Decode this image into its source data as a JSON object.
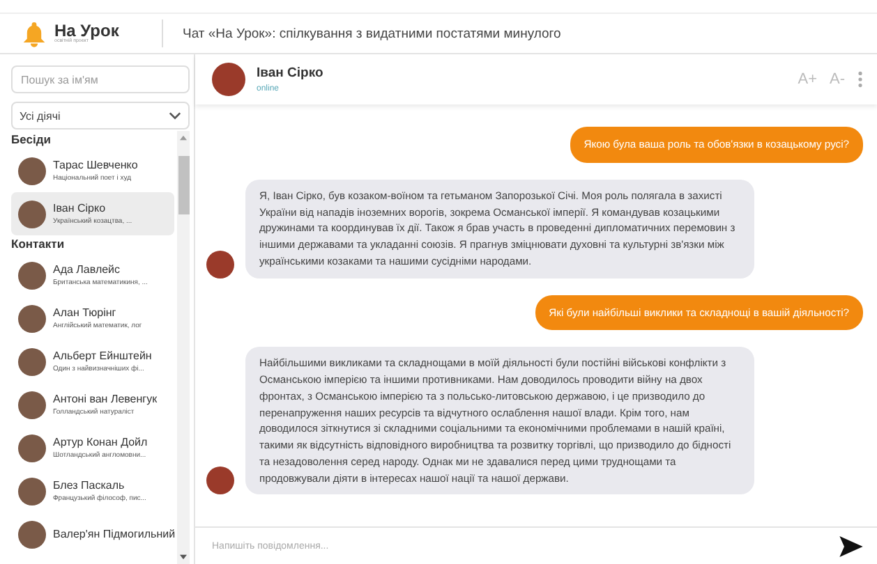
{
  "header": {
    "logo": "На Урок",
    "logo_tagline": "освітній проект",
    "title": "Чат «На Урок»: спілкування з видатними постатями минулого"
  },
  "sidebar": {
    "search": {
      "placeholder": "Пошук за ім'ям"
    },
    "filter": "Усі діячі",
    "sections": [
      {
        "title": "Бесіди",
        "items": [
          {
            "name": "Тарас Шевченко",
            "subtitle": "Національний поет і худ",
            "selected": false
          },
          {
            "name": "Іван Сірко",
            "subtitle": "Український козацтва, ...",
            "selected": true
          }
        ]
      },
      {
        "title": "Контакти",
        "items": [
          {
            "name": "Ада Лавлейс",
            "subtitle": "Британська математикиня, ...",
            "selected": false
          },
          {
            "name": "Алан Тюрінг",
            "subtitle": "Англійський математик, лог",
            "selected": false
          },
          {
            "name": "Альберт Ейнштейн",
            "subtitle": "Один з найвизначніших фі...",
            "selected": false
          },
          {
            "name": "Антоні ван Левенгук",
            "subtitle": "Голландський натураліст",
            "selected": false
          },
          {
            "name": "Артур Конан Дойл",
            "subtitle": "Шотландський англомовни...",
            "selected": false
          },
          {
            "name": "Блез Паскаль",
            "subtitle": "Французький філософ, пис...",
            "selected": false
          },
          {
            "name": "Валер'ян Підмогильний",
            "selected": false
          }
        ]
      }
    ]
  },
  "chat": {
    "name": "Іван Сірко",
    "status": "online",
    "font_up": "A+",
    "font_down": "A-",
    "messages": [
      {
        "kind": "user",
        "text": "Якою була ваша роль та обов'язки в козацькому русі?"
      },
      {
        "kind": "bot",
        "text": "Я, Іван Сірко, був козаком-воїном та гетьманом Запорозької Січі. Моя роль полягала в захисті України від нападів іноземних ворогів, зокрема Османської імперії. Я командував козацькими дружинами та координував їх дії. Також я брав участь в проведенні дипломатичних перемовин з іншими державами та укладанні союзів. Я прагнув зміцнювати духовні та культурні зв'язки між українськими козаками та нашими сусідніми народами."
      },
      {
        "kind": "user",
        "text": "Які були найбільші виклики та складнощі в вашій діяльності?"
      },
      {
        "kind": "bot",
        "text": "Найбільшими викликами та складнощами в моїй діяльності були постійні військові конфлікти з Османською імперією та іншими противниками. Нам доводилось проводити війну на двох фронтах, з Османською імперією та з польсько-литовською державою, і це призводило до перенапруження наших ресурсів та відчутного ослаблення нашої влади. Крім того, нам доводилося зіткнутися зі складними соціальними та економічними проблемами в нашій країні, такими як відсутність відповідного виробництва та розвитку торгівлі, що призводило до бідності та незадоволення серед народу. Однак ми не здавалися перед цими труднощами та продовжували діяти в інтересах нашої нації та нашої держави."
      }
    ],
    "input": {
      "placeholder": "Напишіть повідомлення..."
    }
  }
}
